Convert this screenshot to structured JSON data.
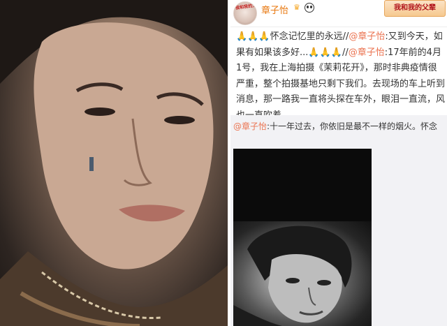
{
  "post": {
    "username": "章子怡",
    "crown_icon": "crown-icon",
    "panda_icon": "panda-icon",
    "avatar_caption": "我和我的父辈",
    "badge_label": "我和我的父辈",
    "text_segments": [
      {
        "kind": "emoji",
        "text": "🙏🙏🙏"
      },
      {
        "kind": "plain",
        "text": "怀念记忆里的永远//"
      },
      {
        "kind": "mention",
        "text": "@章子怡"
      },
      {
        "kind": "plain",
        "text": ":又到今天，如果有如果该多好..."
      },
      {
        "kind": "emoji",
        "text": "🙏🙏🙏"
      },
      {
        "kind": "plain",
        "text": "//"
      },
      {
        "kind": "mention",
        "text": "@章子怡"
      },
      {
        "kind": "plain",
        "text": ":17年前的4月1号，我在上海拍摄《茉莉花开》，那时非典疫情很严重，整个拍摄基地只剩下我们。去现场的车上听到消息，那一路我一直将头探在车外，眼泪一直流，风也一直吹着..."
      }
    ]
  },
  "repost": {
    "mention": "@章子怡",
    "text": ":十一年过去，你依旧是最不一样的烟火。怀念"
  },
  "colors": {
    "username": "#e8770e",
    "mention": "#eb7350",
    "repost_bg": "#f2f2f5"
  }
}
